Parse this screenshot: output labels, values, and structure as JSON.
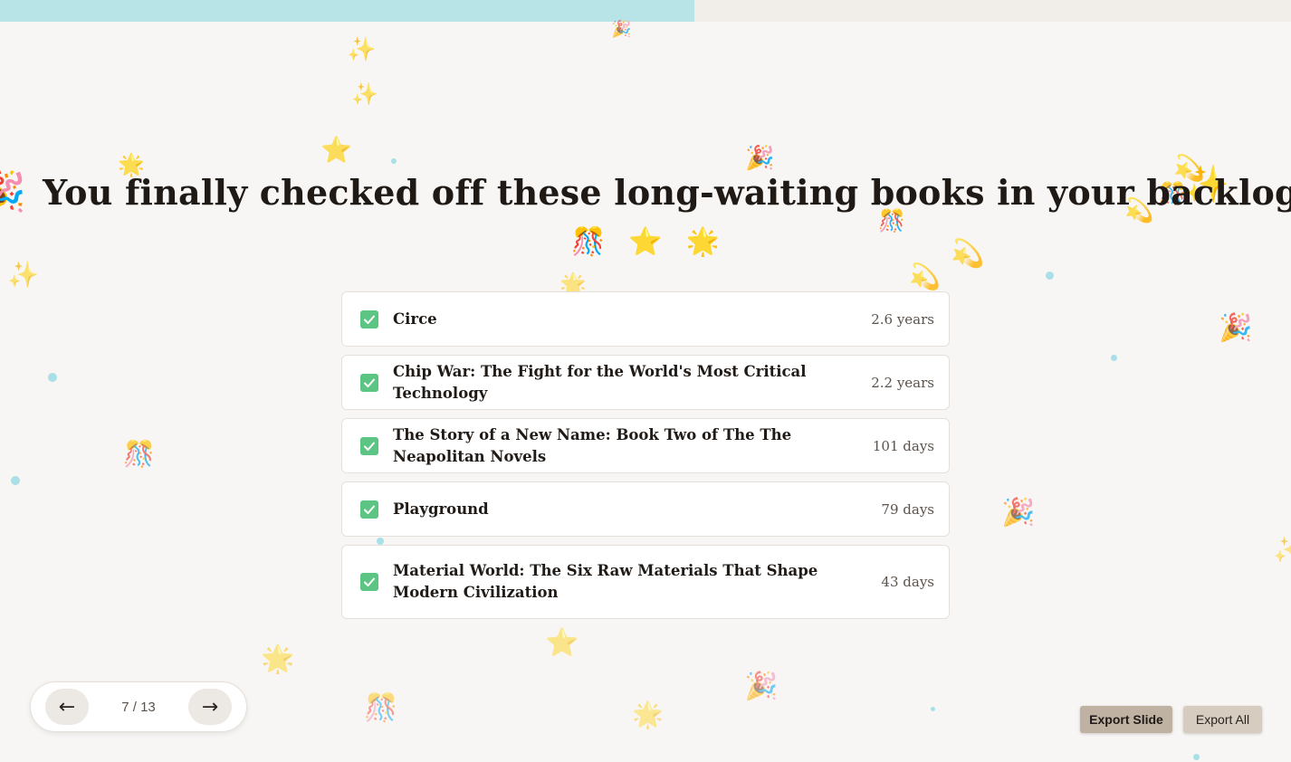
{
  "progress": {
    "fraction": 0.538,
    "color": "#b8e4e7"
  },
  "slide": {
    "heading": "You finally checked off these long-waiting books in your backlog!",
    "heading_emoji": "🎉",
    "emoji_row": [
      "🎊",
      "⭐",
      "🌟"
    ]
  },
  "books": [
    {
      "title": "Circe",
      "age": "2.6 years",
      "checked": true
    },
    {
      "title": "Chip War: The Fight for the World's Most Critical Technology",
      "age": "2.2 years",
      "checked": true
    },
    {
      "title": "The Story of a New Name: Book Two of The The Neapolitan Novels",
      "age": "101 days",
      "checked": true
    },
    {
      "title": "Playground",
      "age": "79 days",
      "checked": true
    },
    {
      "title": "Material World: The Six Raw Materials That Shape Modern Civilization",
      "age": "43 days",
      "checked": true
    }
  ],
  "nav": {
    "prev_label": "←",
    "next_label": "→",
    "page_indicator": "7 / 13"
  },
  "export": {
    "slide_label": "Export Slide",
    "all_label": "Export All"
  },
  "icons": {
    "checkbox": "checked-checkbox-icon",
    "confetti": [
      "party-popper-icon",
      "star-icon",
      "sparkles-icon",
      "glowing-star-icon",
      "dizzy-icon"
    ]
  },
  "colors": {
    "background": "#f8f6f4",
    "check": "#5cc584",
    "export_slide": "#bfb2a2",
    "export_all": "#d6ccc0"
  }
}
